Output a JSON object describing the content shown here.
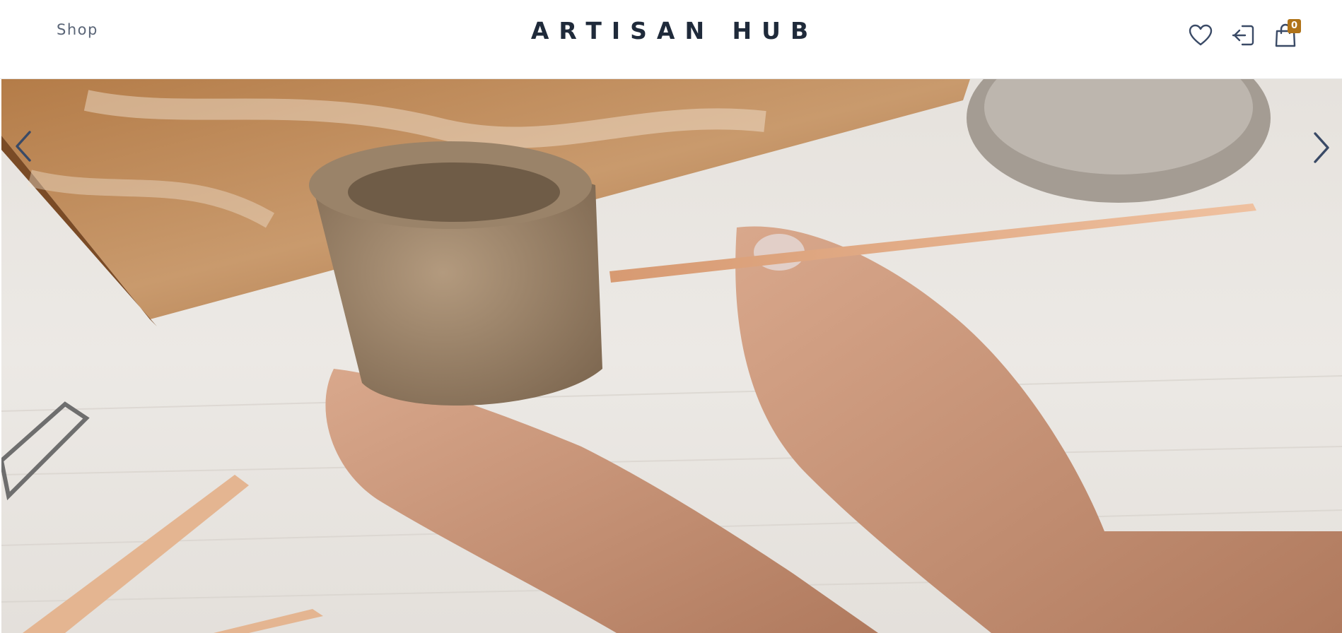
{
  "nav": {
    "shop_label": "Shop"
  },
  "brand": {
    "title": "ARTISAN HUB"
  },
  "header_icons": {
    "wishlist_icon": "heart-icon",
    "login_icon": "sign-in-icon",
    "cart_icon": "shopping-bag-icon",
    "cart_count": "0",
    "badge_color": "#b07318",
    "icon_color": "#3a4a66"
  },
  "hero": {
    "image_subject": "hands-shaping-clay-cup-photo",
    "prev_icon": "chevron-left-icon",
    "next_icon": "chevron-right-icon"
  }
}
